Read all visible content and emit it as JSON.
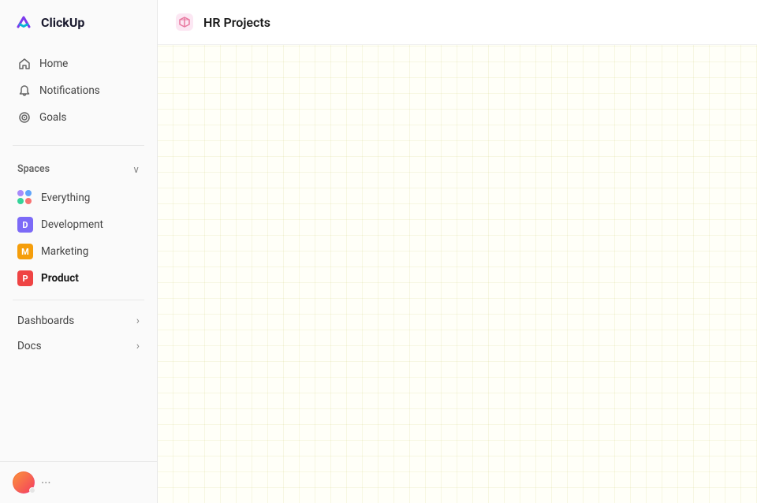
{
  "app": {
    "name": "ClickUp"
  },
  "sidebar": {
    "logo_text": "ClickUp",
    "nav_items": [
      {
        "id": "home",
        "label": "Home",
        "icon": "home"
      },
      {
        "id": "notifications",
        "label": "Notifications",
        "icon": "bell"
      },
      {
        "id": "goals",
        "label": "Goals",
        "icon": "target"
      }
    ],
    "spaces_label": "Spaces",
    "spaces": [
      {
        "id": "everything",
        "label": "Everything",
        "type": "dots",
        "color": ""
      },
      {
        "id": "development",
        "label": "Development",
        "type": "avatar",
        "color": "#7c6af7",
        "letter": "D"
      },
      {
        "id": "marketing",
        "label": "Marketing",
        "type": "avatar",
        "color": "#f59e0b",
        "letter": "M"
      },
      {
        "id": "product",
        "label": "Product",
        "type": "avatar",
        "color": "#ef4444",
        "letter": "P",
        "active": true
      }
    ],
    "expandable_items": [
      {
        "id": "dashboards",
        "label": "Dashboards"
      },
      {
        "id": "docs",
        "label": "Docs"
      }
    ]
  },
  "header": {
    "page_title": "HR Projects",
    "page_icon": "cube"
  },
  "icons": {
    "home": "⌂",
    "bell": "🔔",
    "target": "◎",
    "chevron_down": "∨",
    "chevron_right": "›",
    "cube": "⬡"
  }
}
